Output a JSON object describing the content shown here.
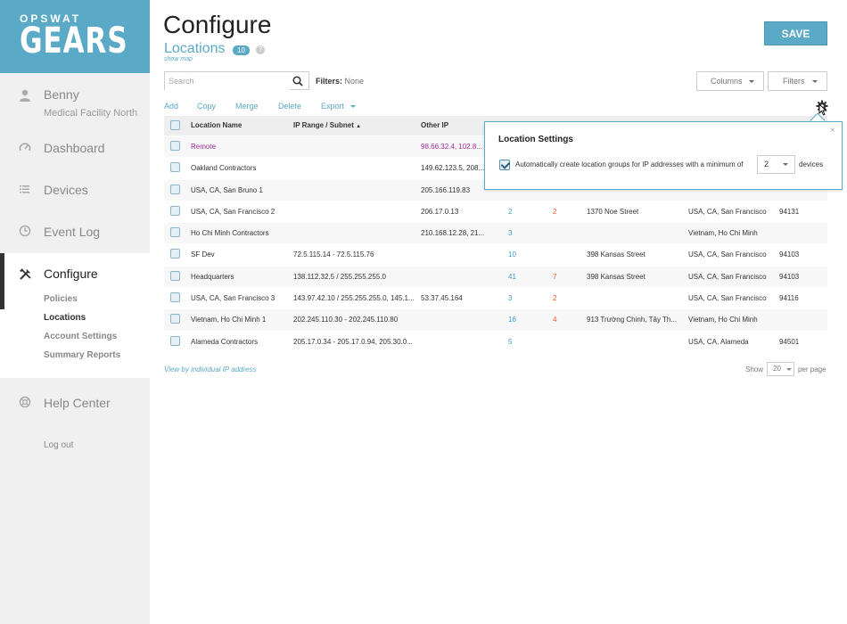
{
  "brand": {
    "top": "OPSWAT",
    "main": "GEARS"
  },
  "user": {
    "name": "Benny",
    "org": "Medical Facility North"
  },
  "nav": {
    "dashboard": "Dashboard",
    "devices": "Devices",
    "event_log": "Event Log",
    "configure": "Configure",
    "sub": [
      "Policies",
      "Locations",
      "Account Settings",
      "Summary Reports"
    ],
    "help": "Help Center",
    "logout": "Log out"
  },
  "header": {
    "title": "Configure",
    "subtitle": "Locations",
    "count": "10",
    "help": "?",
    "show_map": "show map",
    "save": "SAVE"
  },
  "search": {
    "placeholder": "Search"
  },
  "filters": {
    "label": "Filters:",
    "value": "None"
  },
  "buttons": {
    "columns": "Columns",
    "filters": "Filters"
  },
  "actions": {
    "add": "Add",
    "copy": "Copy",
    "merge": "Merge",
    "delete": "Delete",
    "export": "Export"
  },
  "table": {
    "headers": {
      "name": "Location Name",
      "ip": "IP Range / Subnet",
      "sort": "▲",
      "other": "Other IP"
    },
    "rows": [
      {
        "name": "Remote",
        "ip": "",
        "other": "98.66.32.4, 102.8...",
        "count": "",
        "issues": "",
        "address": "",
        "city": "",
        "zip": ""
      },
      {
        "name": "Oakland Contractors",
        "ip": "",
        "other": "149.62.123.5, 208...",
        "count": "",
        "issues": "",
        "address": "",
        "city": "",
        "zip": ""
      },
      {
        "name": "USA, CA, San Bruno 1",
        "ip": "",
        "other": "205.166.119.83",
        "count": "",
        "issues": "",
        "address": "",
        "city": "",
        "zip": ""
      },
      {
        "name": "USA, CA, San Francisco 2",
        "ip": "",
        "other": "206.17.0.13",
        "count": "2",
        "issues": "2",
        "address": "1370 Noe Street",
        "city": "USA, CA, San Francisco",
        "zip": "94131"
      },
      {
        "name": "Ho Chi Minh Contractors",
        "ip": "",
        "other": "210.168.12.28, 21...",
        "count": "3",
        "issues": "",
        "address": "",
        "city": "Vietnam, Ho Chi Minh",
        "zip": ""
      },
      {
        "name": "SF Dev",
        "ip": "72.5.115.14 - 72.5.115.76",
        "other": "",
        "count": "10",
        "issues": "",
        "address": "398 Kansas Street",
        "city": "USA, CA, San Francisco",
        "zip": "94103"
      },
      {
        "name": "Headquarters",
        "ip": "138.112.32.5 / 255.255.255.0",
        "other": "",
        "count": "41",
        "issues": "7",
        "address": "398 Kansas Street",
        "city": "USA, CA, San Francisco",
        "zip": "94103"
      },
      {
        "name": "USA, CA, San Francisco 3",
        "ip": "143.97.42.10 / 255.255.255.0, 145.1...",
        "other": "53.37.45.164",
        "count": "3",
        "issues": "2",
        "address": "",
        "city": "USA, CA, San Francisco",
        "zip": "94116"
      },
      {
        "name": "Vietnam, Ho Chi Minh 1",
        "ip": "202.245.110.30 - 202.245.110.80",
        "other": "",
        "count": "16",
        "issues": "4",
        "address": "913 Trường Chinh, Tây Th...",
        "city": "Vietnam, Ho Chi Minh",
        "zip": ""
      },
      {
        "name": "Alameda Contractors",
        "ip": "205.17.0.34 - 205.17.0.94, 205.30.0...",
        "other": "",
        "count": "5",
        "issues": "",
        "address": "",
        "city": "USA, CA, Alameda",
        "zip": "94501"
      }
    ]
  },
  "footer": {
    "view_ip": "View by individual IP address",
    "show": "Show",
    "per_page_value": "20",
    "per_page": "per page"
  },
  "popover": {
    "title": "Location Settings",
    "close": "×",
    "text": "Automatically create location groups for IP addresses with a minimum of",
    "min_value": "2",
    "devices": "devices"
  },
  "colors": {
    "accent": "#5aa9c7",
    "remote": "#a42d9a",
    "count": "#3a9bcf",
    "issues": "#e0562b"
  }
}
